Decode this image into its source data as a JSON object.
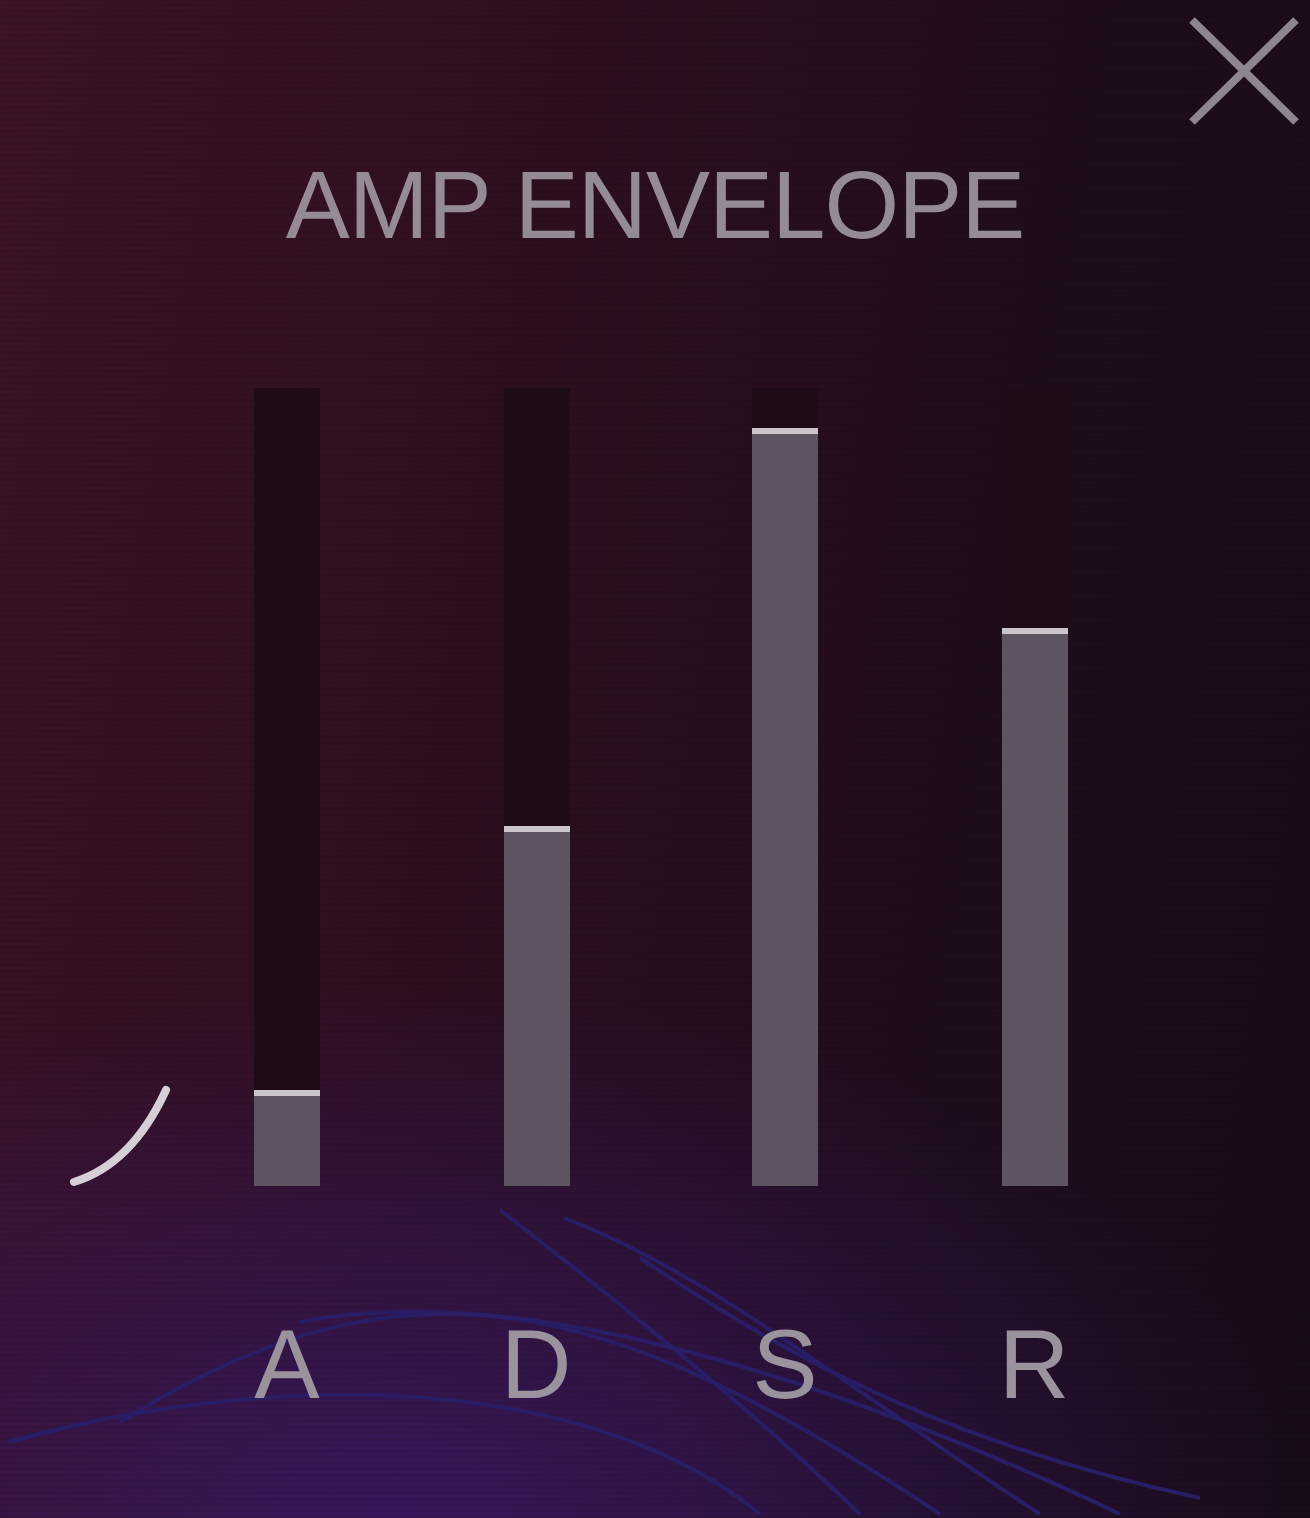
{
  "panel": {
    "title": "AMP ENVELOPE"
  },
  "sliders": [
    {
      "label": "A",
      "level": 0.12
    },
    {
      "label": "D",
      "level": 0.45
    },
    {
      "label": "S",
      "level": 0.95
    },
    {
      "label": "R",
      "level": 0.7
    }
  ]
}
